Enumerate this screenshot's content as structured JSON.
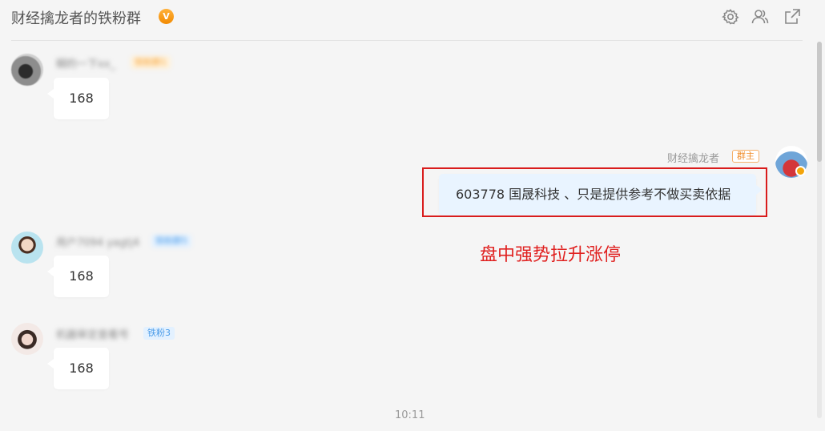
{
  "header": {
    "title": "财经擒龙者的铁粉群",
    "verified_badge": "V",
    "icons": [
      "gear-icon",
      "members-icon",
      "popout-icon"
    ]
  },
  "messages": [
    {
      "sender": "糊的一下xx_",
      "badge": "铁粉群1",
      "text": "168"
    },
    {
      "sender": "财经擒龙者",
      "badge": "群主",
      "text": "603778 国晟科技 、只是提供参考不做买卖依据",
      "self": true
    },
    {
      "sender": "用户7094 yagtj4",
      "badge": "铁粉群5",
      "text": "168"
    },
    {
      "sender": "机器审定查看号",
      "badge": "铁粉3",
      "text": "168"
    }
  ],
  "annotation": {
    "text": "盘中强势拉升涨停"
  },
  "footer": {
    "time": "10:11"
  },
  "colors": {
    "accent_red": "#e0201f",
    "self_bubble": "#e9f4ff",
    "owner_badge": "#f08d2b"
  }
}
